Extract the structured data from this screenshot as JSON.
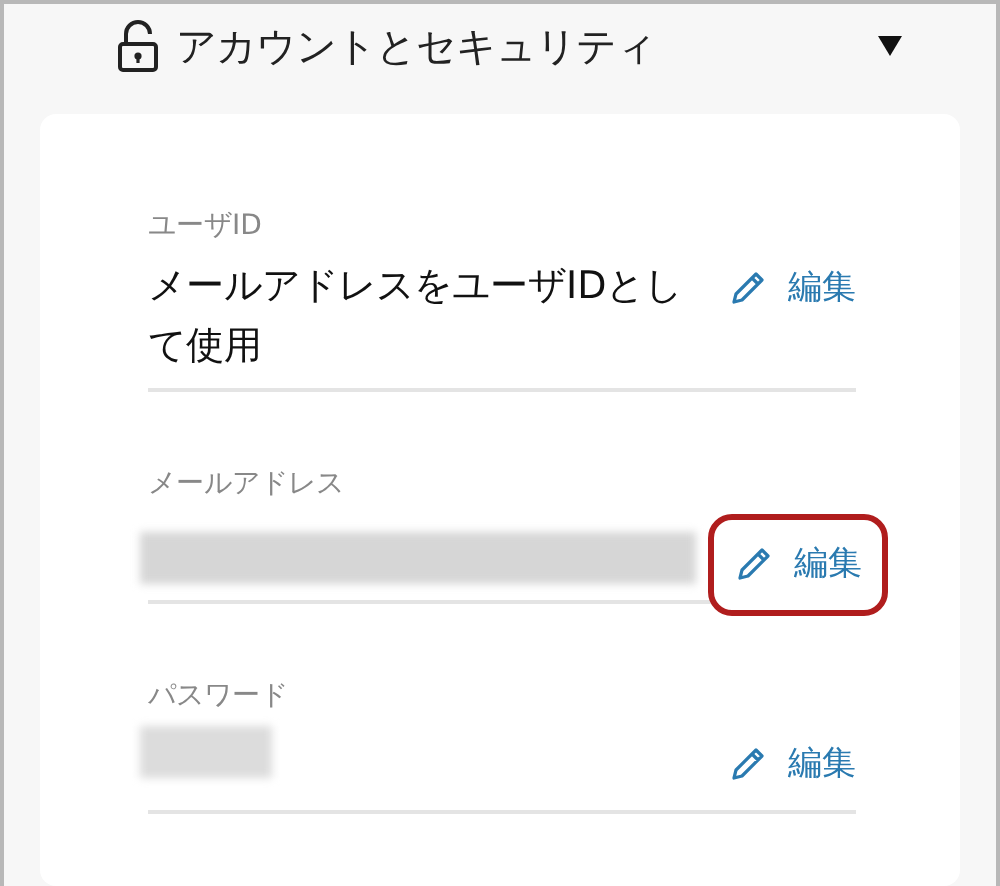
{
  "section": {
    "title": "アカウントとセキュリティ",
    "expanded": true
  },
  "fields": [
    {
      "label": "ユーザID",
      "kind": "text",
      "value": "メールアドレスをユーザIDとして使用",
      "edit": "編集",
      "highlighted": false
    },
    {
      "label": "メールアドレス",
      "kind": "redacted",
      "edit": "編集",
      "highlighted": true
    },
    {
      "label": "パスワード",
      "kind": "redacted-short",
      "edit": "編集",
      "highlighted": false
    }
  ]
}
